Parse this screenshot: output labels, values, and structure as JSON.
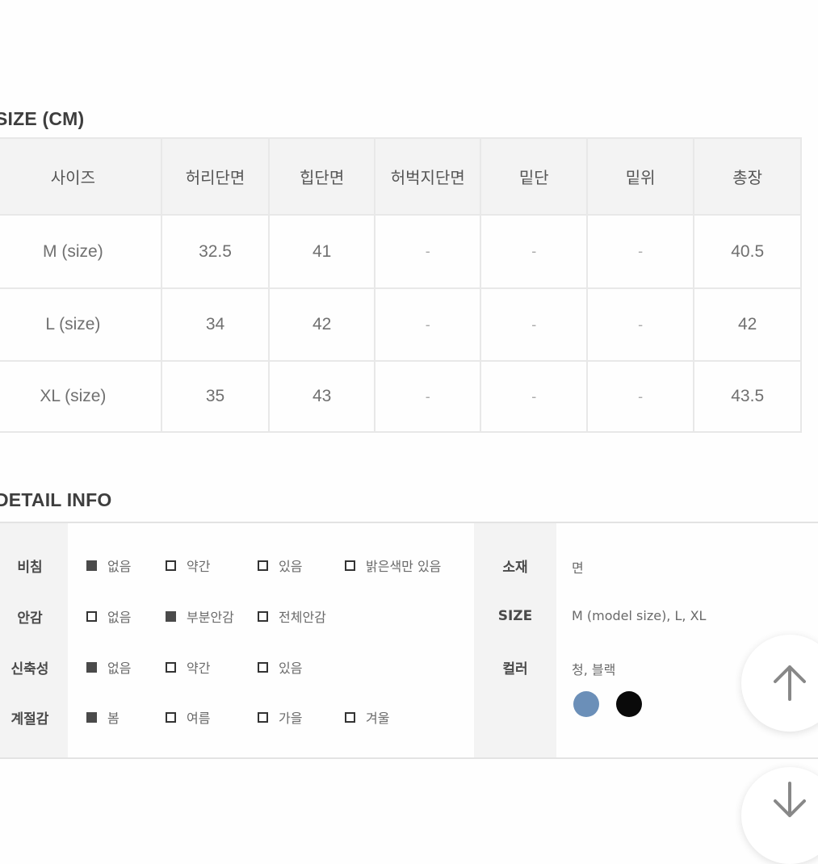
{
  "size_section": {
    "title": "SIZE (CM)",
    "headers": [
      "사이즈",
      "허리단면",
      "힙단면",
      "허벅지단면",
      "밑단",
      "밑위",
      "총장"
    ],
    "rows": [
      [
        "M (size)",
        "32.5",
        "41",
        "-",
        "-",
        "-",
        "40.5"
      ],
      [
        "L (size)",
        "34",
        "42",
        "-",
        "-",
        "-",
        "42"
      ],
      [
        "XL (size)",
        "35",
        "43",
        "-",
        "-",
        "-",
        "43.5"
      ]
    ]
  },
  "detail_section": {
    "title": "DETAIL INFO",
    "attributes": [
      {
        "label": "비침",
        "options": [
          {
            "text": "없음",
            "checked": true
          },
          {
            "text": "약간",
            "checked": false
          },
          {
            "text": "있음",
            "checked": false
          },
          {
            "text": "밝은색만 있음",
            "checked": false
          }
        ]
      },
      {
        "label": "안감",
        "options": [
          {
            "text": "없음",
            "checked": false
          },
          {
            "text": "부분안감",
            "checked": true
          },
          {
            "text": "전체안감",
            "checked": false
          }
        ]
      },
      {
        "label": "신축성",
        "options": [
          {
            "text": "없음",
            "checked": true
          },
          {
            "text": "약간",
            "checked": false
          },
          {
            "text": "있음",
            "checked": false
          }
        ]
      },
      {
        "label": "계절감",
        "options": [
          {
            "text": "봄",
            "checked": true
          },
          {
            "text": "여름",
            "checked": false
          },
          {
            "text": "가을",
            "checked": false
          },
          {
            "text": "겨울",
            "checked": false
          }
        ]
      }
    ],
    "material": {
      "label": "소재",
      "value": "면"
    },
    "size": {
      "label": "SIZE",
      "value": "M (model size), L, XL"
    },
    "color": {
      "label": "컬러",
      "value": "청, 블랙",
      "swatches": [
        "#6b8fb8",
        "#0a0a0a"
      ]
    }
  },
  "floating_buttons": {
    "scroll_up_icon": "arrow-up-icon",
    "scroll_down_icon": "arrow-down-icon",
    "icon_color": "#888888"
  }
}
